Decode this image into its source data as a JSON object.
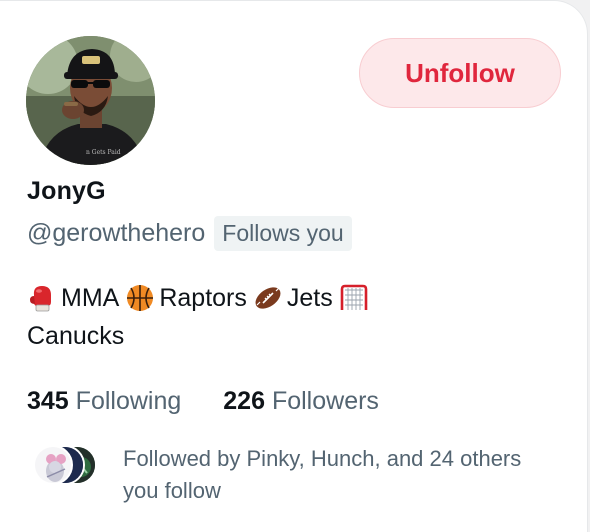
{
  "profile": {
    "display_name": "JonyG",
    "handle": "@gerowthehero",
    "follows_you_badge": "Follows you",
    "avatar_icon": "profile-photo-icon"
  },
  "actions": {
    "unfollow_label": "Unfollow"
  },
  "bio": {
    "segments": [
      {
        "icon": "boxing-glove-icon",
        "text": "MMA"
      },
      {
        "icon": "basketball-icon",
        "text": "Raptors"
      },
      {
        "icon": "football-icon",
        "text": "Jets"
      },
      {
        "icon": "hockey-goal-icon",
        "text": "Canucks"
      }
    ]
  },
  "stats": {
    "following_count": "345",
    "following_label": "Following",
    "followers_count": "226",
    "followers_label": "Followers"
  },
  "followed_by": {
    "text": "Followed by Pinky, Hunch, and 24 others you follow"
  },
  "colors": {
    "unfollow_text": "#e0263d",
    "unfollow_bg": "#fde8ea",
    "secondary_text": "#536471",
    "primary_text": "#0f1419"
  }
}
